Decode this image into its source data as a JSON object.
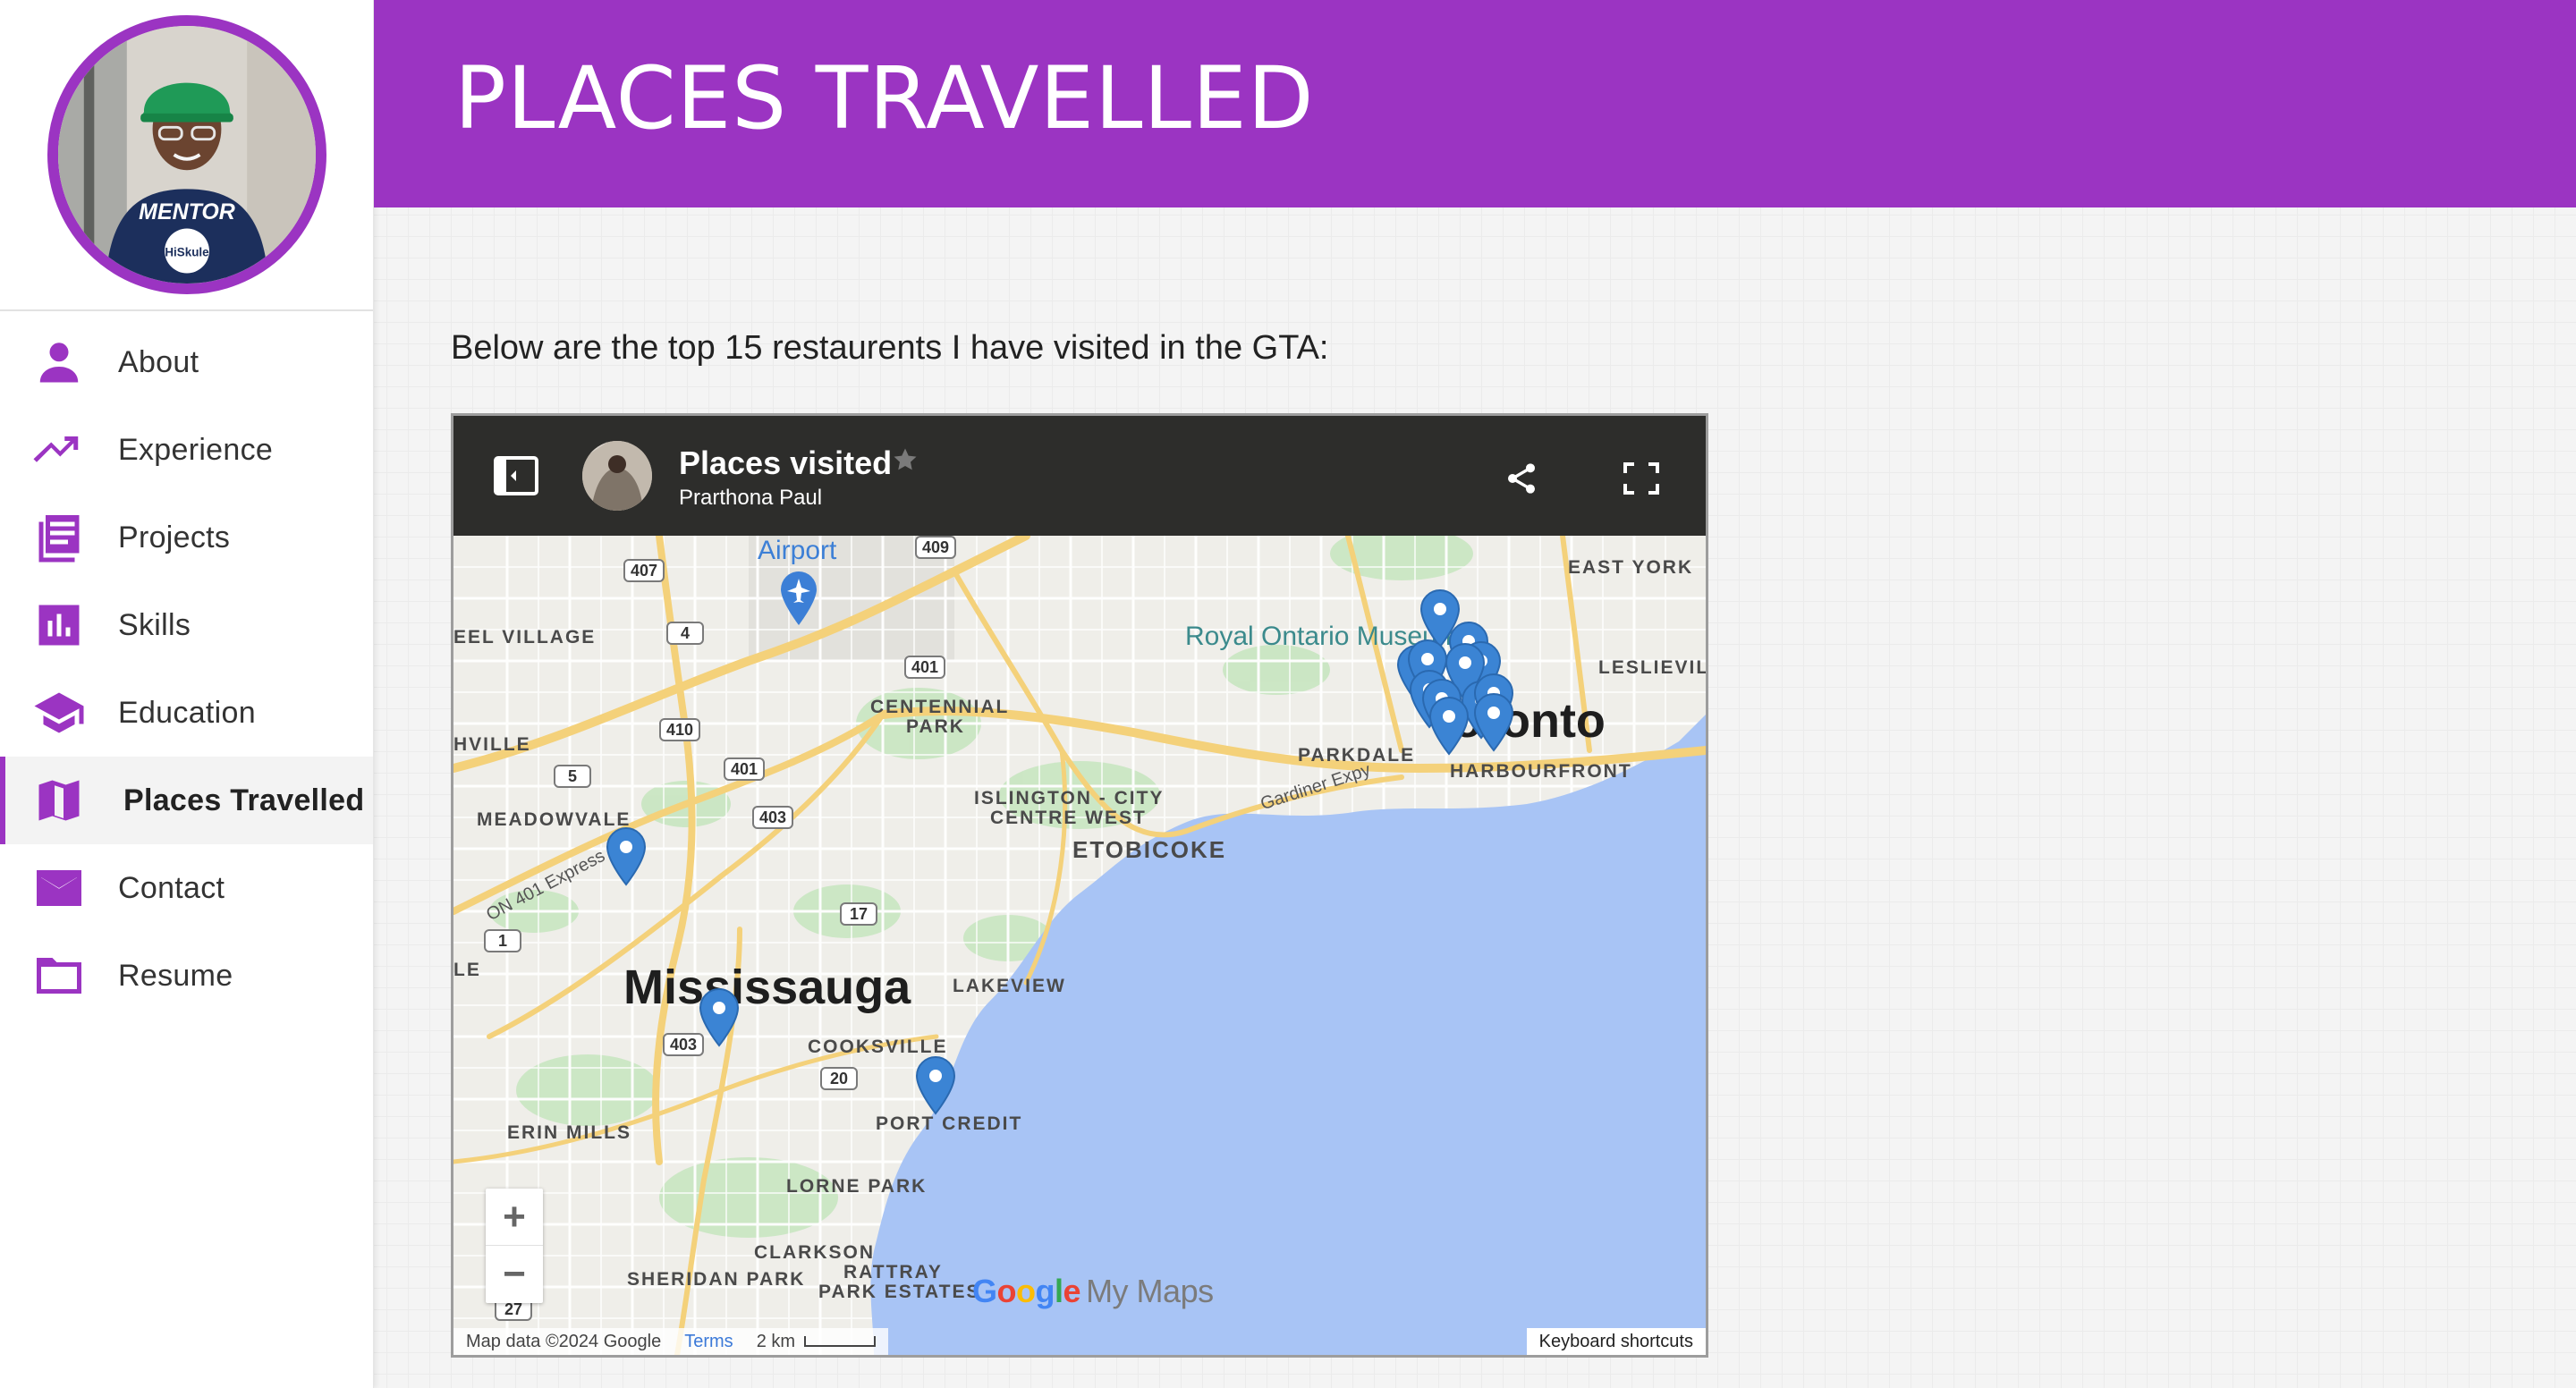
{
  "colors": {
    "accent": "#9b34c2",
    "map_water": "#a8c4f5",
    "map_land": "#efeee9",
    "map_park": "#c8e6c1",
    "map_road_major": "#f4d17a",
    "pin": "#3b84d4",
    "map_header": "#2d2d2b"
  },
  "sidebar": {
    "items": [
      {
        "label": "About",
        "icon": "person-icon"
      },
      {
        "label": "Experience",
        "icon": "trending-up-icon"
      },
      {
        "label": "Projects",
        "icon": "article-icon"
      },
      {
        "label": "Skills",
        "icon": "bar-chart-icon"
      },
      {
        "label": "Education",
        "icon": "graduation-cap-icon"
      },
      {
        "label": "Places Travelled",
        "icon": "map-icon",
        "active": true
      },
      {
        "label": "Contact",
        "icon": "mail-icon"
      },
      {
        "label": "Resume",
        "icon": "folder-icon"
      }
    ]
  },
  "avatar": {
    "shirt_text": "MENTOR",
    "logo_text": "HiSkule"
  },
  "header": {
    "title": "PLACES TRAVELLED"
  },
  "content": {
    "intro": "Below are the top 15 restaurents I have visited in the GTA:"
  },
  "map": {
    "title": "Places visited",
    "owner": "Prarthona Paul",
    "labels": {
      "airport": "Airport",
      "east_york": "EAST YORK",
      "eel_village": "EEL VILLAGE",
      "rom": "Royal Ontario Museum",
      "leslieville": "LESLIEVILL",
      "centennial_park_1": "CENTENNIAL",
      "centennial_park_2": "PARK",
      "toronto": "Toronto",
      "harbourfront": "HARBOURFRONT",
      "parkdale": "PARKDALE",
      "hville": "HVILLE",
      "gardiner": "Gardiner Expy",
      "islington_1": "ISLINGTON - CITY",
      "islington_2": "CENTRE WEST",
      "meadowvale": "MEADOWVALE",
      "etobicoke": "ETOBICOKE",
      "on401": "ON 401 Express",
      "mississauga": "Mississauga",
      "lakeview": "LAKEVIEW",
      "le": "LE",
      "cooksville": "COOKSVILLE",
      "port_credit": "PORT CREDIT",
      "erin_mills": "ERIN MILLS",
      "lorne_park": "LORNE PARK",
      "clarkson": "CLARKSON",
      "sheridan_park": "SHERIDAN PARK",
      "rattray_1": "RATTRAY",
      "rattray_2": "PARK ESTATES"
    },
    "shields": [
      "407",
      "409",
      "4",
      "401",
      "410",
      "401",
      "5",
      "403",
      "17",
      "1",
      "403",
      "20",
      "27"
    ],
    "pin_count": 15,
    "zoom_in": "+",
    "zoom_out": "−",
    "logo_google": [
      "G",
      "o",
      "o",
      "g",
      "l",
      "e"
    ],
    "logo_my_maps": "My Maps",
    "attribution": "Map data ©2024 Google",
    "terms": "Terms",
    "scale": "2 km",
    "keyboard_shortcuts": "Keyboard shortcuts"
  }
}
